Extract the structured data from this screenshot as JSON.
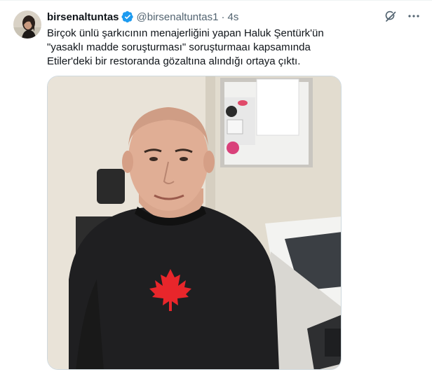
{
  "author": {
    "display_name": "birsenaltuntas",
    "handle": "@birsenaltuntas1",
    "separator": "·",
    "time": "4s"
  },
  "tweet": {
    "text": "Birçok ünlü şarkıcının menajerliğini yapan Haluk Şentürk'ün \"yasaklı madde soruşturması\" soruşturmaaı kapsamında Etiler'deki bir restoranda gözaltına alındığı ortaya çıktı."
  },
  "icons": {
    "verified": "verified-badge-icon",
    "grok": "grok-icon",
    "more": "more-icon"
  },
  "colors": {
    "verified": "#1d9bf0",
    "text": "#0f1419",
    "secondary": "#536471",
    "border": "#cfd9de",
    "leaf": "#e8262b"
  }
}
